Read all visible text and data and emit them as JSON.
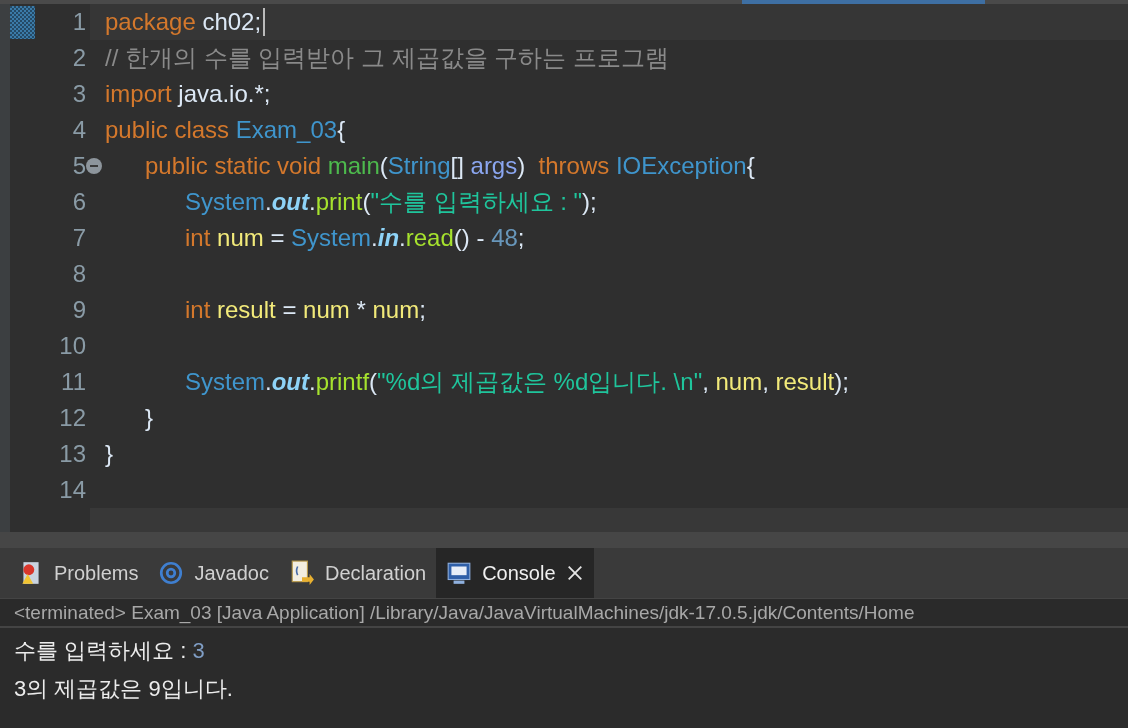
{
  "editor": {
    "lines": [
      {
        "number": "1",
        "current": true,
        "collapsible": false,
        "tokens": [
          {
            "text": "package",
            "kind": "keyword"
          },
          {
            "text": " ch02;",
            "kind": "plain"
          }
        ]
      },
      {
        "number": "2",
        "current": false,
        "collapsible": false,
        "tokens": [
          {
            "text": "// 한개의 수를 입력받아 그 제곱값을 구하는 프로그램",
            "kind": "comment"
          }
        ]
      },
      {
        "number": "3",
        "current": false,
        "collapsible": false,
        "tokens": [
          {
            "text": "import",
            "kind": "keyword"
          },
          {
            "text": " java.io.*;",
            "kind": "plain"
          }
        ]
      },
      {
        "number": "4",
        "current": false,
        "collapsible": false,
        "tokens": [
          {
            "text": "public class ",
            "kind": "keyword"
          },
          {
            "text": "Exam_03",
            "kind": "type"
          },
          {
            "text": "{",
            "kind": "plain"
          }
        ]
      },
      {
        "number": "5",
        "current": false,
        "collapsible": true,
        "tokens": [
          {
            "text": "\tpublic static void ",
            "kind": "keyword"
          },
          {
            "text": "main",
            "kind": "method"
          },
          {
            "text": "(",
            "kind": "plain"
          },
          {
            "text": "String",
            "kind": "type"
          },
          {
            "text": "[] ",
            "kind": "plain"
          },
          {
            "text": "args",
            "kind": "param"
          },
          {
            "text": ")  ",
            "kind": "plain"
          },
          {
            "text": "throws ",
            "kind": "keyword"
          },
          {
            "text": "IOException",
            "kind": "type"
          },
          {
            "text": "{",
            "kind": "plain"
          }
        ]
      },
      {
        "number": "6",
        "current": false,
        "collapsible": false,
        "tokens": [
          {
            "text": "\t\tSystem",
            "kind": "type"
          },
          {
            "text": ".",
            "kind": "plain"
          },
          {
            "text": "out",
            "kind": "field"
          },
          {
            "text": ".",
            "kind": "plain"
          },
          {
            "text": "print",
            "kind": "call"
          },
          {
            "text": "(",
            "kind": "plain"
          },
          {
            "text": "\"수를 입력하세요 : \"",
            "kind": "string"
          },
          {
            "text": ");",
            "kind": "plain"
          }
        ]
      },
      {
        "number": "7",
        "current": false,
        "collapsible": false,
        "tokens": [
          {
            "text": "\t\tint ",
            "kind": "keyword"
          },
          {
            "text": "num",
            "kind": "variable"
          },
          {
            "text": " = ",
            "kind": "plain"
          },
          {
            "text": "System",
            "kind": "type"
          },
          {
            "text": ".",
            "kind": "plain"
          },
          {
            "text": "in",
            "kind": "field"
          },
          {
            "text": ".",
            "kind": "plain"
          },
          {
            "text": "read",
            "kind": "call"
          },
          {
            "text": "() - ",
            "kind": "plain"
          },
          {
            "text": "48",
            "kind": "number"
          },
          {
            "text": ";",
            "kind": "plain"
          }
        ]
      },
      {
        "number": "8",
        "current": false,
        "collapsible": false
      },
      {
        "number": "9",
        "current": false,
        "collapsible": false,
        "tokens": [
          {
            "text": "\t\tint ",
            "kind": "keyword"
          },
          {
            "text": "result",
            "kind": "variable"
          },
          {
            "text": " = ",
            "kind": "plain"
          },
          {
            "text": "num",
            "kind": "variable"
          },
          {
            "text": " * ",
            "kind": "plain"
          },
          {
            "text": "num",
            "kind": "variable"
          },
          {
            "text": ";",
            "kind": "plain"
          }
        ]
      },
      {
        "number": "10",
        "current": false,
        "collapsible": false
      },
      {
        "number": "11",
        "current": false,
        "collapsible": false,
        "tokens": [
          {
            "text": "\t\tSystem",
            "kind": "type"
          },
          {
            "text": ".",
            "kind": "plain"
          },
          {
            "text": "out",
            "kind": "field"
          },
          {
            "text": ".",
            "kind": "plain"
          },
          {
            "text": "printf",
            "kind": "call"
          },
          {
            "text": "(",
            "kind": "plain"
          },
          {
            "text": "\"%d의 제곱값은 %d입니다. \\n\"",
            "kind": "string"
          },
          {
            "text": ", ",
            "kind": "plain"
          },
          {
            "text": "num",
            "kind": "variable"
          },
          {
            "text": ", ",
            "kind": "plain"
          },
          {
            "text": "result",
            "kind": "variable"
          },
          {
            "text": ");",
            "kind": "plain"
          }
        ]
      },
      {
        "number": "12",
        "current": false,
        "collapsible": false,
        "tokens": [
          {
            "text": "\t}",
            "kind": "plain"
          }
        ]
      },
      {
        "number": "13",
        "current": false,
        "collapsible": false,
        "tokens": [
          {
            "text": "}",
            "kind": "plain"
          }
        ]
      },
      {
        "number": "14",
        "current": false,
        "collapsible": false
      }
    ]
  },
  "panel": {
    "tabs": [
      {
        "label": "Problems",
        "selected": false,
        "closable": false
      },
      {
        "label": "Javadoc",
        "selected": false,
        "closable": false
      },
      {
        "label": "Declaration",
        "selected": false,
        "closable": false
      },
      {
        "label": "Console",
        "selected": true,
        "closable": true
      }
    ],
    "console_header": "<terminated> Exam_03 [Java Application] /Library/Java/JavaVirtualMachines/jdk-17.0.5.jdk/Contents/Home",
    "output": [
      [
        {
          "text": "수를 입력하세요 : ",
          "kind": "stdout"
        },
        {
          "text": "3",
          "kind": "stdin"
        }
      ],
      [
        {
          "text": "3의 제곱값은 9입니다.",
          "kind": "stdout"
        }
      ]
    ]
  }
}
